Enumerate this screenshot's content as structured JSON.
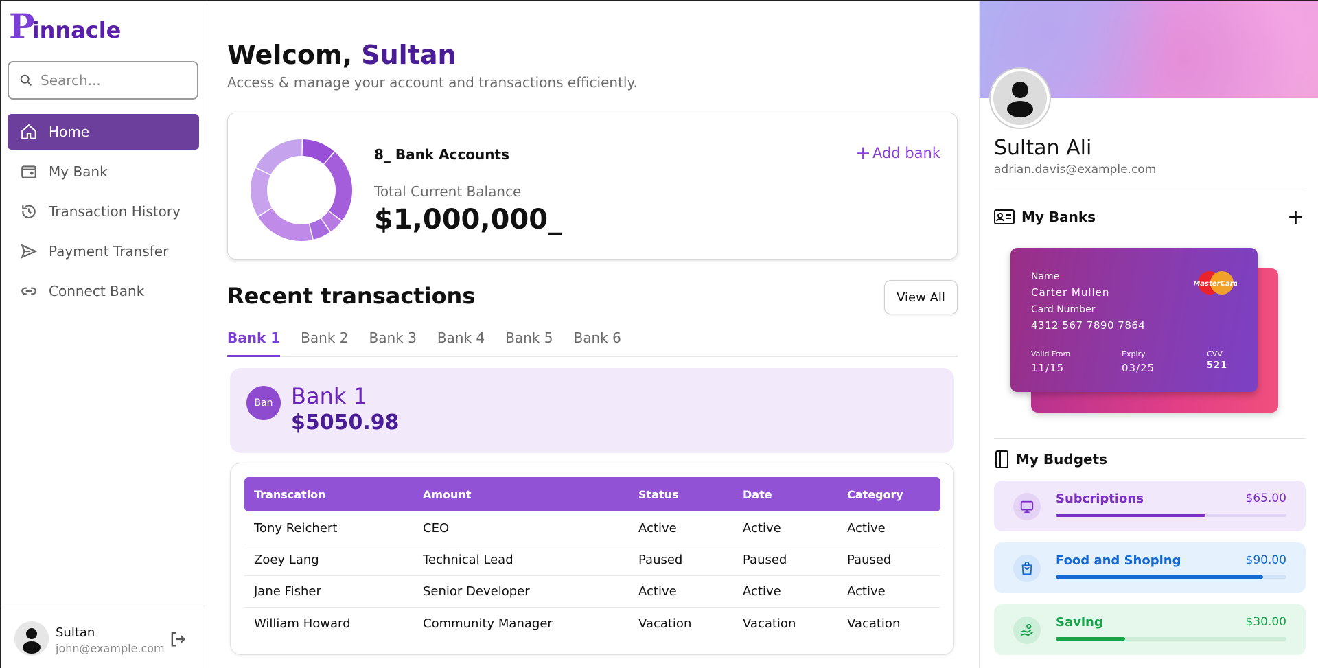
{
  "logo": {
    "first": "P",
    "rest": "innacle"
  },
  "search": {
    "placeholder": "Search..."
  },
  "nav": [
    {
      "label": "Home",
      "icon": "home-icon",
      "active": true
    },
    {
      "label": "My Bank",
      "icon": "wallet-icon"
    },
    {
      "label": "Transaction History",
      "icon": "history-icon"
    },
    {
      "label": "Payment Transfer",
      "icon": "send-icon"
    },
    {
      "label": "Connect Bank",
      "icon": "link-icon"
    }
  ],
  "user": {
    "name": "Sultan",
    "email": "john@example.com"
  },
  "header": {
    "greeting": "Welcom,",
    "name": "Sultan",
    "subtitle": "Access & manage your account and transactions efficiently."
  },
  "balance": {
    "bank_count": "8_ Bank Accounts",
    "add_bank": "Add bank",
    "total_label": "Total Current Balance",
    "total_value": "$1,000,000_",
    "donut_segments": [
      0.11,
      0.24,
      0.05,
      0.06,
      0.2,
      0.16,
      0.18
    ]
  },
  "transactions": {
    "title": "Recent transactions",
    "view_all": "View All",
    "tabs": [
      "Bank 1",
      "Bank 2",
      "Bank 3",
      "Bank 4",
      "Bank 5",
      "Bank 6"
    ],
    "active_tab": 0,
    "bank": {
      "badge": "Ban",
      "name": "Bank 1",
      "amount": "$5050.98"
    },
    "columns": [
      "Transcation",
      "Amount",
      "Status",
      "Date",
      "Category"
    ],
    "rows": [
      [
        "Tony Reichert",
        "CEO",
        "Active",
        "Active",
        "Active"
      ],
      [
        "Zoey Lang",
        "Technical Lead",
        "Paused",
        "Paused",
        "Paused"
      ],
      [
        "Jane Fisher",
        "Senior Developer",
        "Active",
        "Active",
        "Active"
      ],
      [
        "William Howard",
        "Community Manager",
        "Vacation",
        "Vacation",
        "Vacation"
      ]
    ]
  },
  "profile": {
    "name": "Sultan Ali",
    "email": "adrian.davis@example.com"
  },
  "my_banks": {
    "title": "My Banks",
    "add": "+",
    "card": {
      "name_label": "Name",
      "name": "Carter Mullen",
      "number_label": "Card Number",
      "number": "4312 567 7890 7864",
      "valid_label": "Valid From",
      "valid": "11/15",
      "expiry_label": "Expiry",
      "expiry": "03/25",
      "cvv_label": "CVV",
      "cvv": "521",
      "brand": "MasterCard"
    }
  },
  "budgets": {
    "title": "My Budgets",
    "items": [
      {
        "name": "Subcriptions",
        "amount": "$65.00",
        "progress": 0.65,
        "icon": "monitor-icon",
        "bg": "#f1e9fb",
        "accent": "#7b2fc4",
        "track": "#e2d4f3",
        "icon_bg": "#e4d3f5"
      },
      {
        "name": "Food and Shoping",
        "amount": "$90.00",
        "progress": 0.9,
        "icon": "shopping-bag-icon",
        "bg": "#e5f1fd",
        "accent": "#1769d1",
        "track": "#cfe2f7",
        "icon_bg": "#d3e6fb"
      },
      {
        "name": "Saving",
        "amount": "$30.00",
        "progress": 0.3,
        "icon": "saving-hand-icon",
        "bg": "#e6f8ec",
        "accent": "#17a34a",
        "track": "#cfeed9",
        "icon_bg": "#cdeed8"
      }
    ]
  },
  "colors": {
    "brand": "#7b3fd6",
    "brand_dark": "#4a1d96",
    "nav_active": "#6b3f9b",
    "table_head": "#9152d6"
  }
}
